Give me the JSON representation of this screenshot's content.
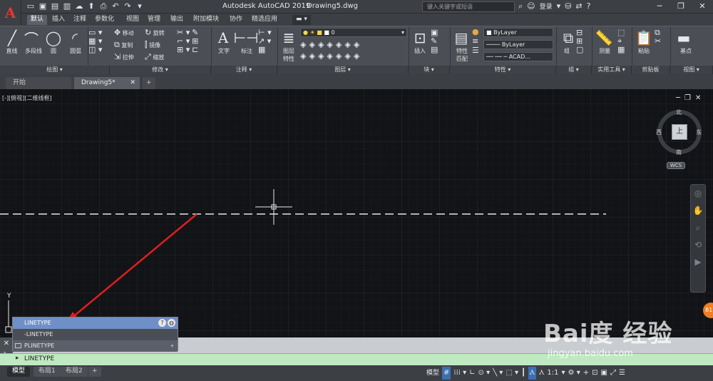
{
  "title_bar": {
    "app_name": "Autodesk AutoCAD 2019",
    "document": "Drawing5.dwg",
    "search_placeholder": "键入关键字或短语",
    "login_label": "登录",
    "app_icon_letter": "A",
    "help_icon": "?"
  },
  "ribbon_tabs": [
    "默认",
    "插入",
    "注释",
    "参数化",
    "视图",
    "管理",
    "输出",
    "附加模块",
    "协作",
    "精选应用"
  ],
  "ribbon": {
    "draw": {
      "line": "直线",
      "polyline": "多段线",
      "circle": "圆",
      "arc": "圆弧"
    },
    "modify": {
      "move": "移动",
      "rotate": "旋转",
      "copy": "复制",
      "mirror": "镜像",
      "stretch": "拉伸",
      "scale": "缩放"
    },
    "annotation": {
      "text": "文字",
      "dimension": "标注"
    },
    "layer": {
      "layer_props": "图层\n特性",
      "layer_value": "0"
    },
    "block": {
      "insert": "插入"
    },
    "properties": {
      "match": "特性\n匹配",
      "color": "ByLayer",
      "linetype": "ByLayer",
      "lineweight": "ACAD..."
    },
    "groups": {
      "group": "组"
    },
    "utilities": {
      "measure": "测量"
    },
    "clipboard": {
      "paste": "粘贴"
    },
    "view": {
      "base": "基点"
    },
    "panels": [
      "绘图",
      "修改",
      "注释",
      "图层",
      "块",
      "特性",
      "组",
      "实用工具",
      "剪贴板",
      "视图"
    ]
  },
  "file_tabs": [
    "开始",
    "Drawing5*"
  ],
  "viewport": {
    "label": "[-][俯视][二维线框]",
    "compass": {
      "north": "北",
      "south": "南",
      "east": "东",
      "west": "西",
      "center": "上",
      "wcs": "WCS"
    },
    "ucs_y": "Y"
  },
  "autocomplete": {
    "items": [
      "LINETYPE",
      "-LINETYPE",
      "PLINETYPE"
    ],
    "selected_index": 0
  },
  "command_line": {
    "value": "LINETYPE",
    "prompt": "▸"
  },
  "layout_tabs": [
    "模型",
    "布局1",
    "布局2"
  ],
  "status_bar": {
    "model_label": "模型",
    "scale": "1:1"
  },
  "watermark": {
    "text": "Bai度 经验",
    "url": "jingyan.baidu.com"
  },
  "colors": {
    "accent": "#e03a2f",
    "canvas": "#121316",
    "ribbon": "#4b4f55",
    "cmd_green": "#bfe9c0"
  }
}
